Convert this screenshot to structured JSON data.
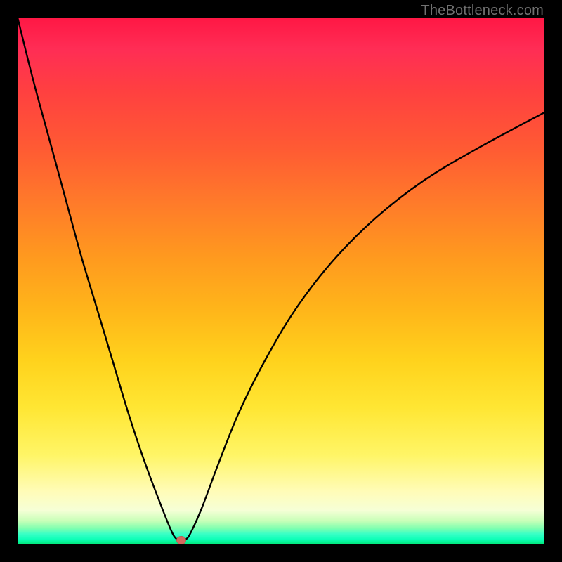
{
  "watermark": {
    "text": "TheBottleneck.com"
  },
  "chart_data": {
    "type": "line",
    "title": "",
    "xlabel": "",
    "ylabel": "",
    "xlim": [
      0,
      100
    ],
    "ylim": [
      0,
      100
    ],
    "grid": false,
    "legend": false,
    "series": [
      {
        "name": "bottleneck-curve",
        "x": [
          0,
          3,
          6,
          9,
          12,
          15,
          18,
          21,
          24,
          27,
          29,
          30,
          31,
          32,
          33,
          35,
          38,
          42,
          47,
          53,
          60,
          68,
          77,
          87,
          100
        ],
        "values": [
          100,
          88,
          77,
          66,
          55,
          45,
          35,
          25,
          16,
          8,
          3,
          1.2,
          0.8,
          1.0,
          2.5,
          7,
          15,
          25,
          35,
          45,
          54,
          62,
          69,
          75,
          82
        ]
      }
    ],
    "marker": {
      "x_pct": 31,
      "y_pct": 0.8
    },
    "background_gradient_stops": [
      {
        "pct": 0,
        "color": "#ff1744"
      },
      {
        "pct": 45,
        "color": "#ff981f"
      },
      {
        "pct": 74,
        "color": "#ffe633"
      },
      {
        "pct": 93,
        "color": "#f6ffd6"
      },
      {
        "pct": 100,
        "color": "#00e676"
      }
    ]
  }
}
